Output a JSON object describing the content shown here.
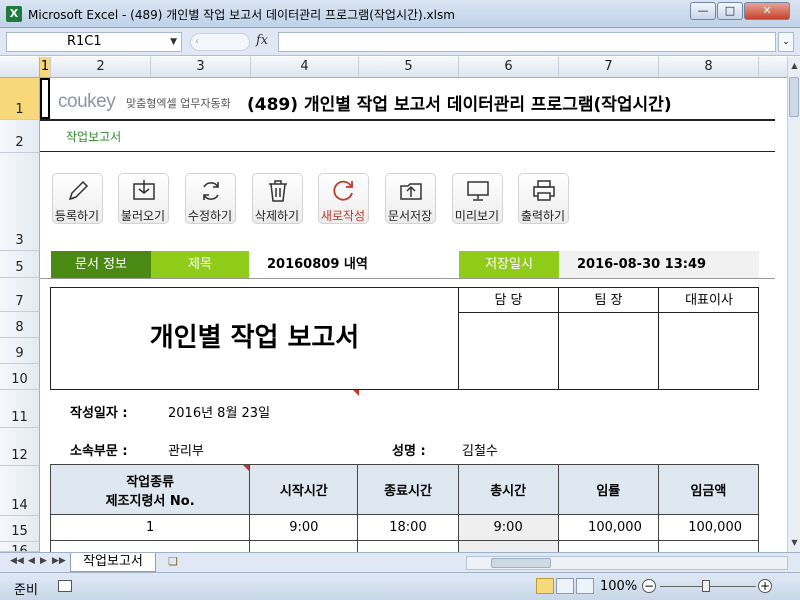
{
  "window": {
    "title": "Microsoft Excel - (489) 개인별 작업 보고서 데이터관리 프로그램(작업시간).xlsm",
    "app_icon": "X"
  },
  "formula_bar": {
    "name_box": "R1C1",
    "fx": "fx",
    "formula": ""
  },
  "columns": [
    "1",
    "2",
    "3",
    "4",
    "5",
    "6",
    "7",
    "8"
  ],
  "rows": [
    "1",
    "2",
    "3",
    "5",
    "7",
    "8",
    "9",
    "10",
    "11",
    "12",
    "14",
    "15",
    "16"
  ],
  "sheet": {
    "logo_text": "coukey",
    "tagline": "맞춤형엑셀 업무자동화",
    "doc_title": "(489) 개인별 작업 보고서 데이터관리 프로그램(작업시간)",
    "caption": "작업보고서",
    "toolbar": [
      {
        "label": "등록하기",
        "icon": "pencil-icon"
      },
      {
        "label": "불러오기",
        "icon": "import-icon"
      },
      {
        "label": "수정하기",
        "icon": "refresh-icon"
      },
      {
        "label": "삭제하기",
        "icon": "trash-icon"
      },
      {
        "label": "새로작성",
        "icon": "new-icon"
      },
      {
        "label": "문서저장",
        "icon": "save-folder-icon"
      },
      {
        "label": "미리보기",
        "icon": "preview-icon"
      },
      {
        "label": "출력하기",
        "icon": "printer-icon"
      }
    ],
    "info": {
      "doc_info_label": "문서 정보",
      "title_label": "제목",
      "title_value": "20160809 내역",
      "saved_label": "저장일시",
      "saved_value": "2016-08-30 13:49"
    },
    "report_title": "개인별 작업 보고서",
    "approvals": [
      "담 당",
      "팀 장",
      "대표이사"
    ],
    "fields": {
      "date_label": "작성일자 :",
      "date_value": "2016년 8월 23일",
      "dept_label": "소속부문 :",
      "dept_value": "관리부",
      "name_label": "성명 :",
      "name_value": "김철수"
    },
    "table": {
      "headers": [
        "작업종류\n제조지령서 No.",
        "시작시간",
        "종료시간",
        "총시간",
        "임률",
        "임금액"
      ],
      "rows": [
        [
          "1",
          "9:00",
          "18:00",
          "9:00",
          "100,000",
          "100,000"
        ]
      ]
    }
  },
  "tabs": {
    "active": "작업보고서"
  },
  "status": {
    "ready": "준비",
    "zoom": "100%"
  },
  "colors": {
    "dark_green": "#4a8a14",
    "light_green": "#92cc1a",
    "header_blue": "#dfe7f1"
  }
}
